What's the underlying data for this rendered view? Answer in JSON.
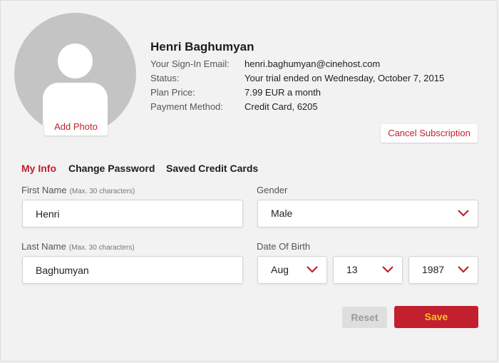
{
  "profile": {
    "name": "Henri Baghumyan",
    "add_photo_label": "Add Photo",
    "rows": [
      {
        "label": "Your Sign-In Email:",
        "value": "henri.baghumyan@cinehost.com"
      },
      {
        "label": "Status:",
        "value": "Your trial ended on Wednesday, October 7, 2015"
      },
      {
        "label": "Plan Price:",
        "value": "7.99 EUR a month"
      },
      {
        "label": "Payment Method:",
        "value": "Credit Card, 6205"
      }
    ],
    "cancel_label": "Cancel Subscription"
  },
  "tabs": [
    {
      "label": "My Info",
      "active": true
    },
    {
      "label": "Change Password",
      "active": false
    },
    {
      "label": "Saved Credit Cards",
      "active": false
    }
  ],
  "form": {
    "first_name": {
      "label": "First Name",
      "hint": "(Max. 30 characters)",
      "value": "Henri"
    },
    "last_name": {
      "label": "Last Name",
      "hint": "(Max. 30 characters)",
      "value": "Baghumyan"
    },
    "gender": {
      "label": "Gender",
      "value": "Male"
    },
    "dob": {
      "label": "Date Of Birth",
      "month": "Aug",
      "day": "13",
      "year": "1987"
    }
  },
  "buttons": {
    "reset": "Reset",
    "save": "Save"
  },
  "colors": {
    "accent": "#c21f2f",
    "save_text": "#f5c518",
    "background": "#f2f2f2"
  }
}
